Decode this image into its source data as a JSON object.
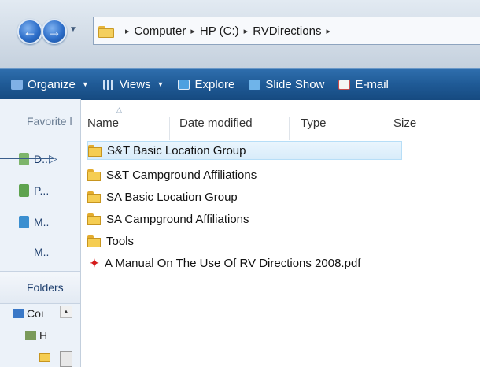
{
  "breadcrumb": {
    "items": [
      "Computer",
      "HP (C:)",
      "RVDirections"
    ],
    "separator": "▸"
  },
  "toolbar": {
    "organize": "Organize",
    "views": "Views",
    "explore": "Explore",
    "slideshow": "Slide Show",
    "email": "E-mail"
  },
  "left_pane": {
    "favorites_label": "Favorite l",
    "items": [
      "D...",
      "P...",
      "M..",
      "M.."
    ],
    "folders_label": "Folders",
    "tree": [
      "Coı",
      "H"
    ]
  },
  "columns": [
    "Name",
    "Date modified",
    "Type",
    "Size"
  ],
  "files": [
    {
      "name": "S&T Basic Location Group",
      "kind": "folder",
      "selected": true
    },
    {
      "name": "S&T Campground Affiliations",
      "kind": "folder"
    },
    {
      "name": "SA Basic Location Group",
      "kind": "folder"
    },
    {
      "name": "SA Campground Affiliations",
      "kind": "folder"
    },
    {
      "name": "Tools",
      "kind": "folder"
    },
    {
      "name": "A Manual On The Use Of RV Directions 2008.pdf",
      "kind": "pdf"
    }
  ],
  "colors": {
    "toolbar": "#1f5a96",
    "selection": "#d8ecfa",
    "folder": "#f5cd52",
    "pdf": "#d41a1a"
  }
}
